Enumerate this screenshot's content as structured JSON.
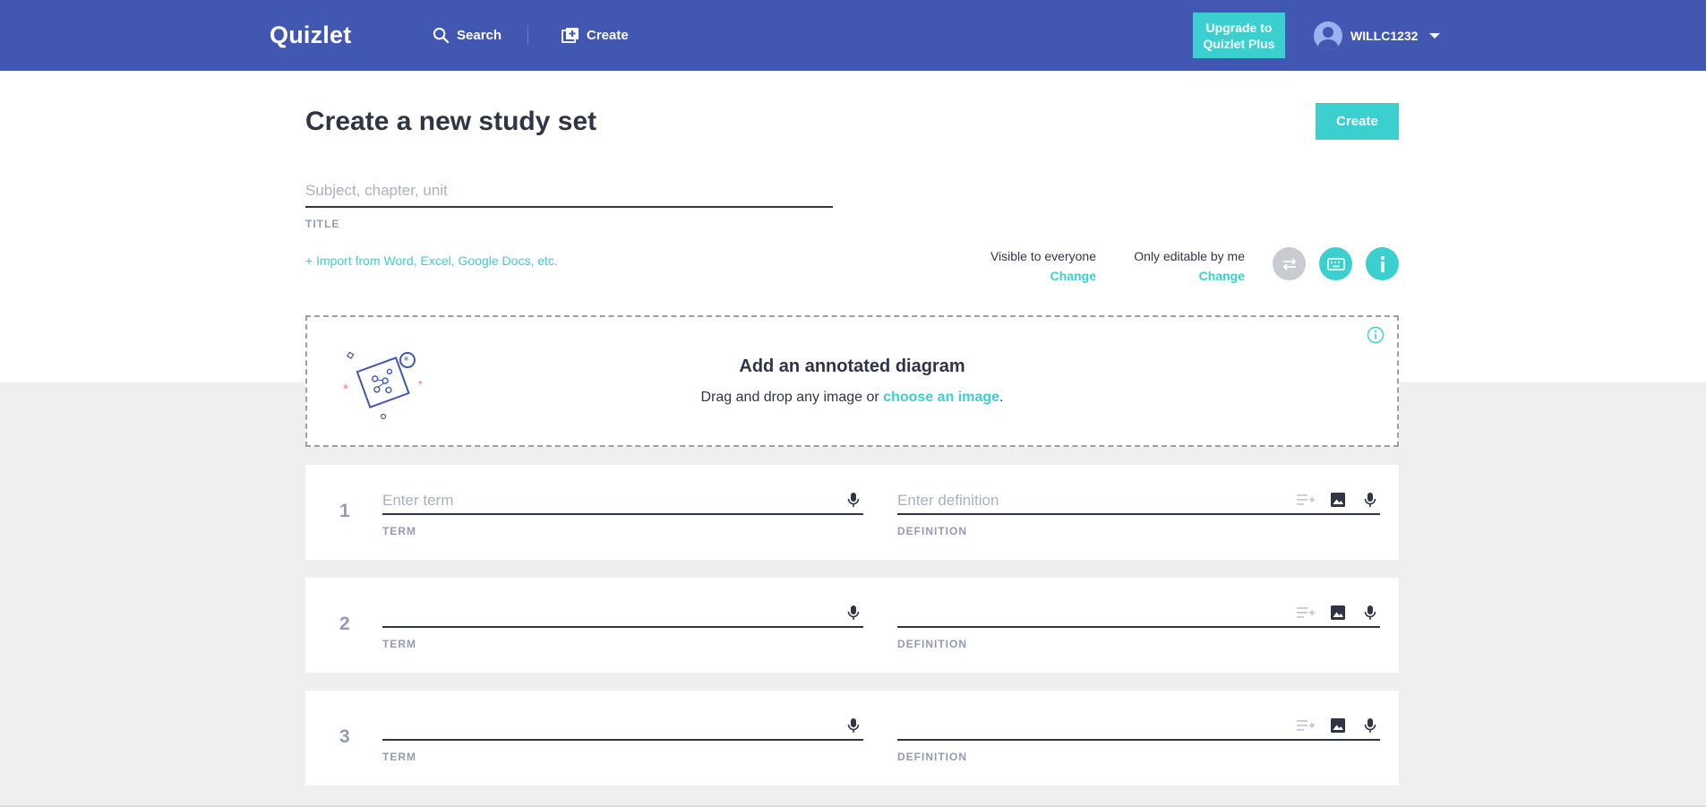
{
  "header": {
    "logo": "Quizlet",
    "search_label": "Search",
    "create_label": "Create",
    "upgrade_line1": "Upgrade to",
    "upgrade_line2": "Quizlet Plus",
    "username": "WILLC1232"
  },
  "page": {
    "title": "Create a new study set",
    "create_button": "Create",
    "title_placeholder": "Subject, chapter, unit",
    "title_label": "TITLE",
    "import_link": "+ Import from Word, Excel, Google Docs, etc.",
    "visibility_text": "Visible to everyone",
    "visibility_change": "Change",
    "editable_text": "Only editable by me",
    "editable_change": "Change"
  },
  "diagram": {
    "title": "Add an annotated diagram",
    "subtitle_prefix": "Drag and drop any image or",
    "choose_link": "choose an image",
    "subtitle_suffix": "."
  },
  "cards": [
    {
      "number": "1",
      "term_placeholder": "Enter term",
      "definition_placeholder": "Enter definition",
      "term_label": "TERM",
      "definition_label": "DEFINITION"
    },
    {
      "number": "2",
      "term_placeholder": "",
      "definition_placeholder": "",
      "term_label": "TERM",
      "definition_label": "DEFINITION"
    },
    {
      "number": "3",
      "term_placeholder": "",
      "definition_placeholder": "",
      "term_label": "TERM",
      "definition_label": "DEFINITION"
    }
  ],
  "colors": {
    "header_bg": "#4257b2",
    "accent": "#3ccfcf",
    "text": "#303545",
    "muted": "#939bb4"
  }
}
